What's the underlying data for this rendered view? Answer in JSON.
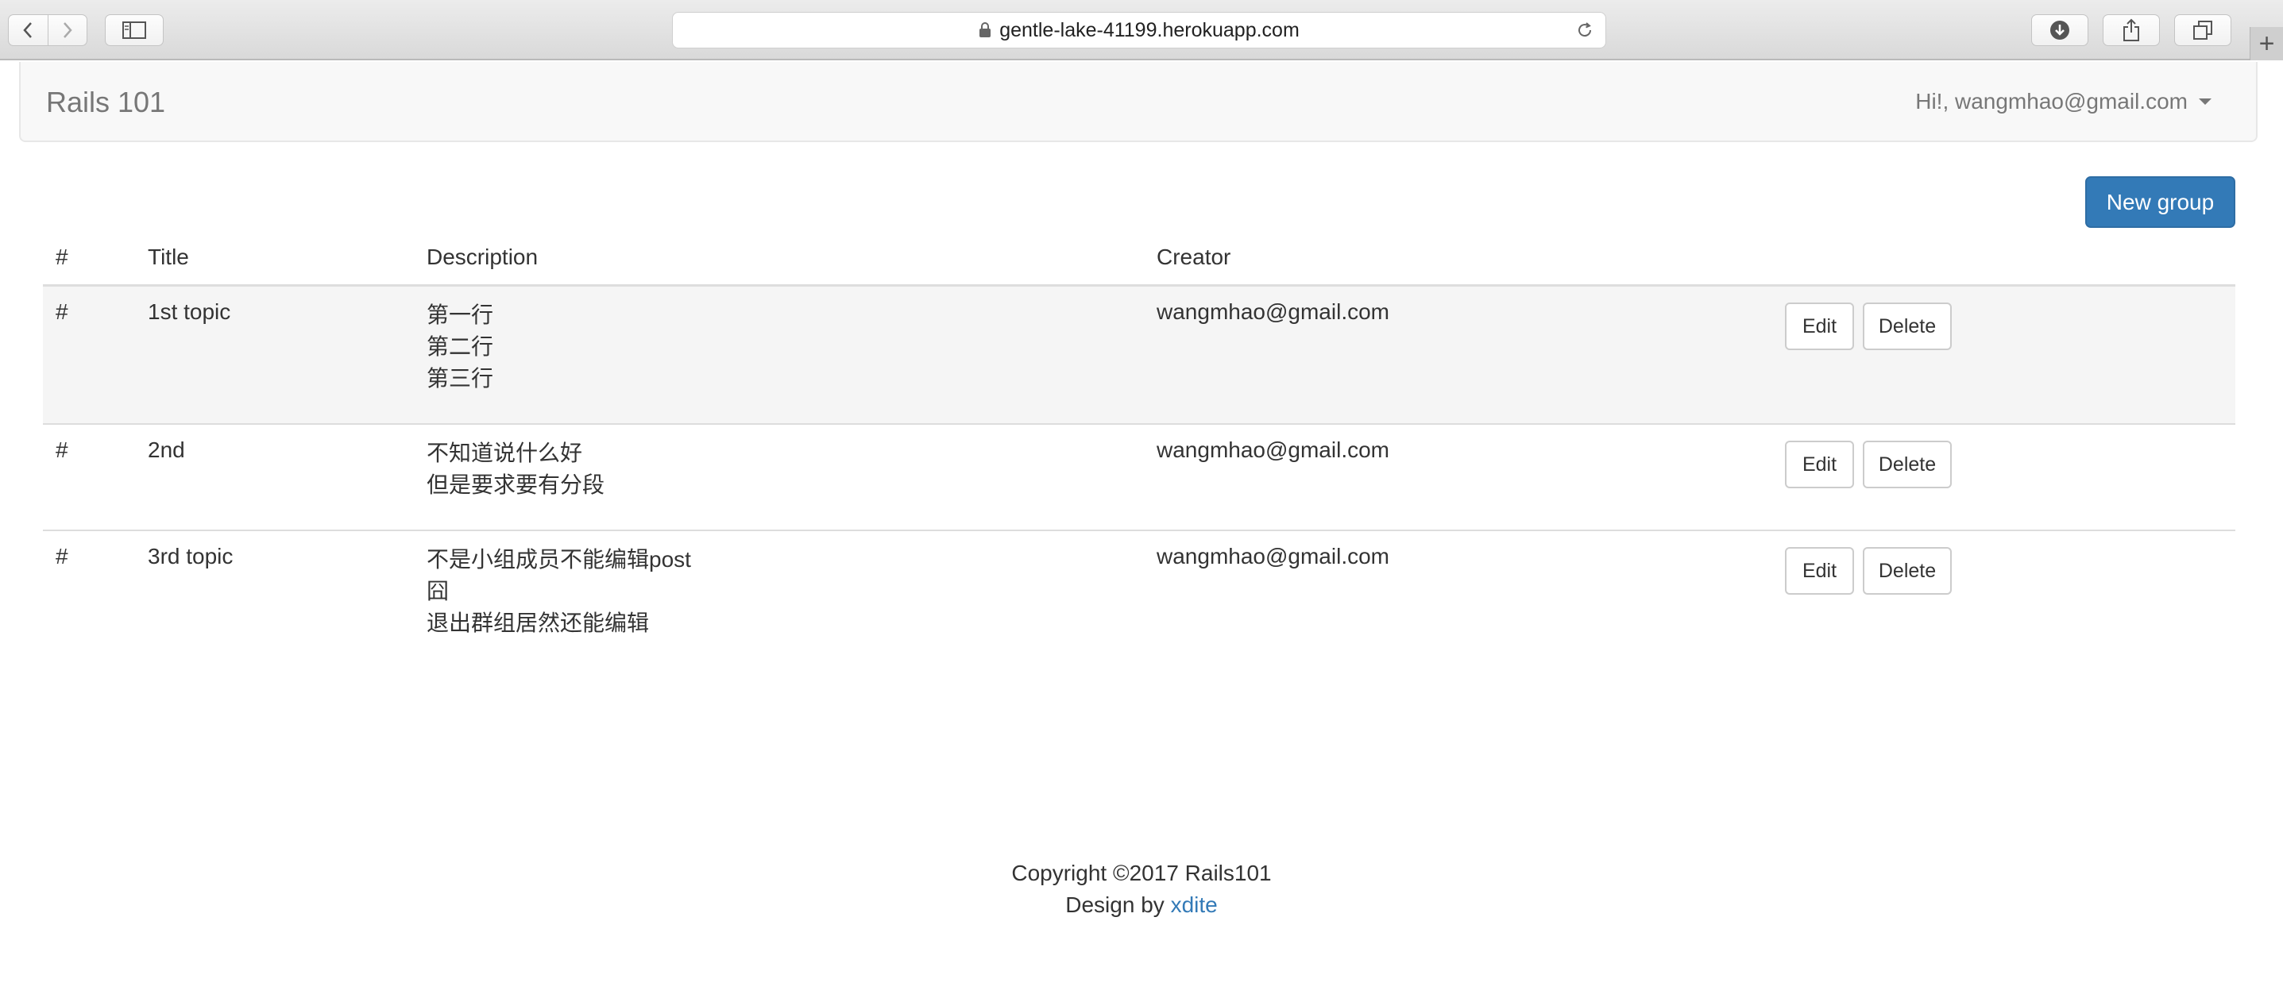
{
  "browser": {
    "url": "gentle-lake-41199.herokuapp.com",
    "new_tab_symbol": "+"
  },
  "navbar": {
    "brand": "Rails 101",
    "user_greeting": "Hi!, wangmhao@gmail.com"
  },
  "toolbar": {
    "new_group_label": "New group"
  },
  "table": {
    "headers": {
      "hash": "#",
      "title": "Title",
      "description": "Description",
      "creator": "Creator"
    },
    "rows": [
      {
        "hash": "#",
        "title": "1st topic",
        "description_lines": [
          "第一行",
          "第二行",
          "第三行"
        ],
        "creator": "wangmhao@gmail.com",
        "edit_label": "Edit",
        "delete_label": "Delete"
      },
      {
        "hash": "#",
        "title": "2nd",
        "description_lines": [
          "不知道说什么好",
          "但是要求要有分段"
        ],
        "creator": "wangmhao@gmail.com",
        "edit_label": "Edit",
        "delete_label": "Delete"
      },
      {
        "hash": "#",
        "title": "3rd topic",
        "description_lines": [
          "不是小组成员不能编辑post",
          "囧",
          "退出群组居然还能编辑"
        ],
        "creator": "wangmhao@gmail.com",
        "edit_label": "Edit",
        "delete_label": "Delete"
      }
    ]
  },
  "footer": {
    "copyright": "Copyright ©2017 Rails101",
    "design_by": "Design by",
    "designer_link": "xdite"
  },
  "colors": {
    "link": "#337ab7",
    "primary_button": "#337ab7",
    "navbar_bg": "#f8f8f8",
    "stripe": "#f5f5f5"
  },
  "icons": [
    "back-icon",
    "forward-icon",
    "sidebar-icon",
    "lock-icon",
    "reload-icon",
    "download-icon",
    "share-icon",
    "tabs-icon",
    "caret-down-icon"
  ]
}
